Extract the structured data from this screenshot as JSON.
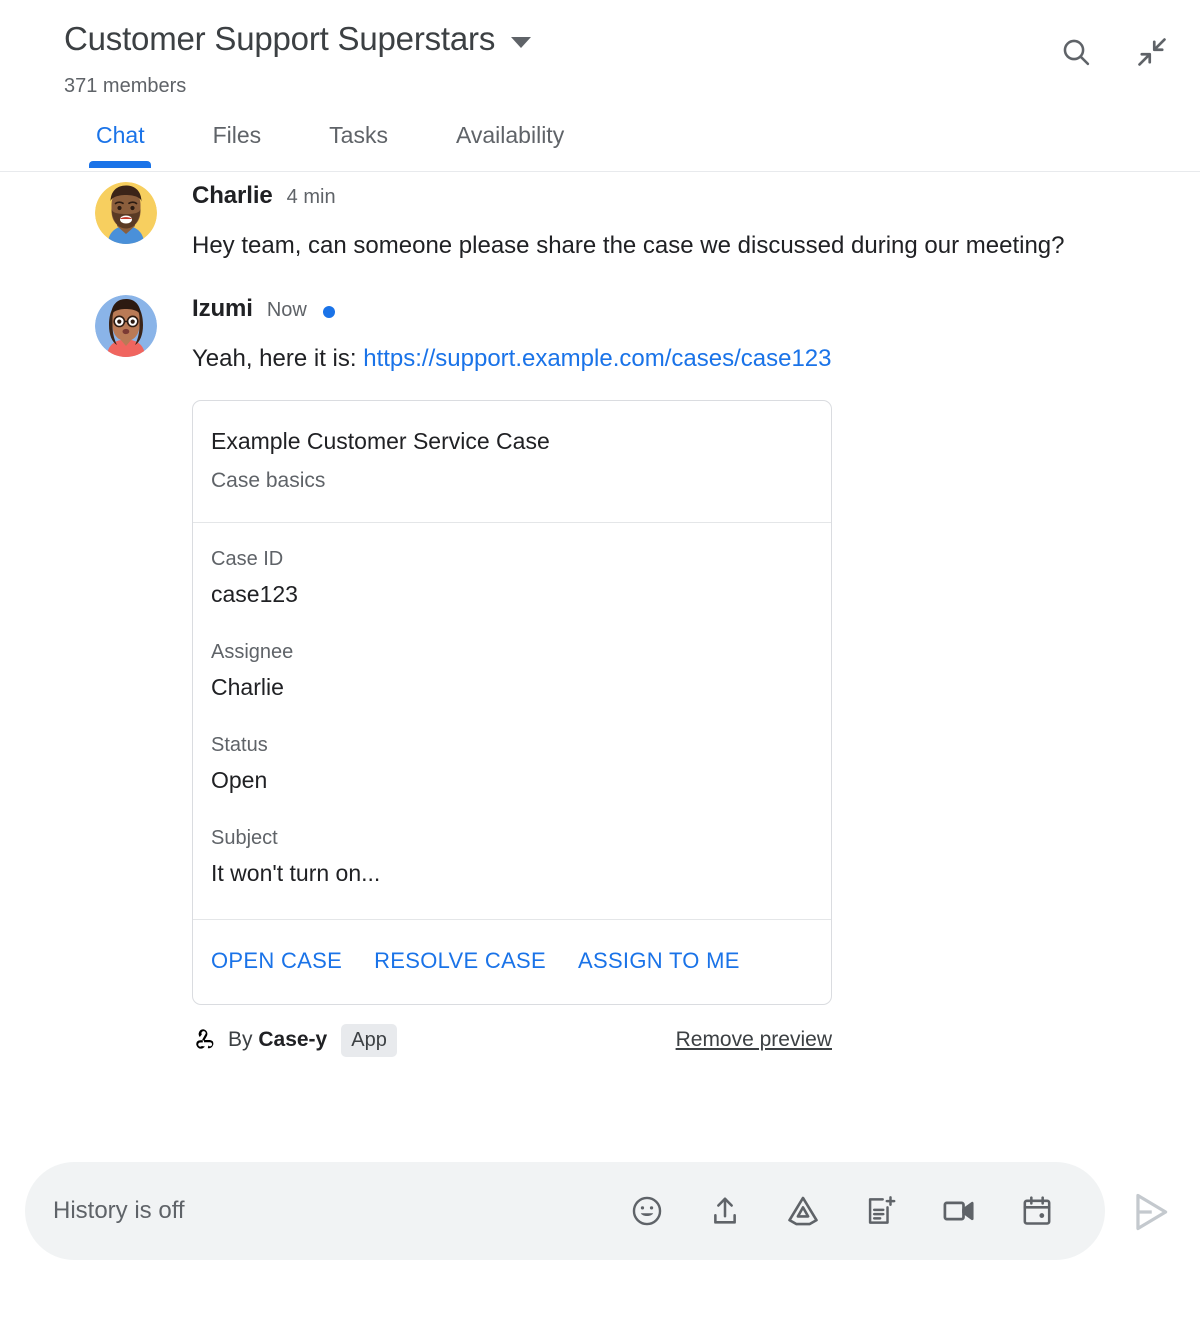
{
  "header": {
    "room_title": "Customer Support Superstars",
    "member_count": "371 members",
    "dropdown_icon": "chevron-down-icon",
    "search_icon": "search-icon",
    "collapse_icon": "collapse-icon"
  },
  "tabs": [
    {
      "label": "Chat",
      "active": true
    },
    {
      "label": "Files",
      "active": false
    },
    {
      "label": "Tasks",
      "active": false
    },
    {
      "label": "Availability",
      "active": false
    }
  ],
  "messages": [
    {
      "sender": "Charlie",
      "timestamp": "4 min",
      "text": "Hey team, can someone please share the case we discussed during our meeting?",
      "unread": false
    },
    {
      "sender": "Izumi",
      "timestamp": "Now",
      "text_prefix": "Yeah, here it is: ",
      "link_text": "https://support.example.com/cases/case123",
      "unread": true
    }
  ],
  "card": {
    "title": "Example Customer Service Case",
    "subtitle": "Case basics",
    "fields": [
      {
        "label": "Case ID",
        "value": "case123"
      },
      {
        "label": "Assignee",
        "value": "Charlie"
      },
      {
        "label": "Status",
        "value": "Open"
      },
      {
        "label": "Subject",
        "value": "It won't turn on..."
      }
    ],
    "actions": [
      {
        "label": "OPEN CASE"
      },
      {
        "label": "RESOLVE CASE"
      },
      {
        "label": "ASSIGN TO ME"
      }
    ],
    "footer": {
      "app_icon": "webhook-icon",
      "by_prefix": "By ",
      "app_name": "Case-y",
      "app_badge": "App",
      "remove_preview": "Remove preview"
    }
  },
  "compose": {
    "placeholder": "History is off",
    "icons": [
      "emoji-icon",
      "upload-icon",
      "google-drive-icon",
      "new-document-icon",
      "video-camera-icon",
      "calendar-icon"
    ],
    "send_icon": "send-icon"
  },
  "colors": {
    "accent_blue": "#1a73e8",
    "text_primary": "#202124",
    "text_secondary": "#5f6368",
    "border": "#dadce0",
    "compose_bg": "#f1f3f4",
    "badge_bg": "#e8eaed",
    "send_disabled": "#c4c9ce"
  }
}
